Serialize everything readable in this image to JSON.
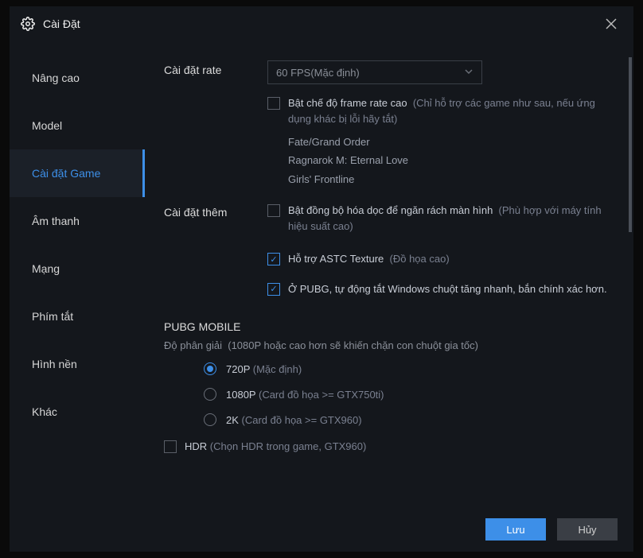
{
  "window": {
    "title": "Cài Đặt"
  },
  "sidebar": {
    "items": [
      {
        "label": "Nâng cao"
      },
      {
        "label": "Model"
      },
      {
        "label": "Cài đặt Game"
      },
      {
        "label": "Âm thanh"
      },
      {
        "label": "Mạng"
      },
      {
        "label": "Phím tắt"
      },
      {
        "label": "Hình nền"
      },
      {
        "label": "Khác"
      }
    ]
  },
  "rate": {
    "label": "Cài đặt rate",
    "selected": "60 FPS(Mặc định)",
    "highfps_label": "Bật chế độ frame rate cao",
    "highfps_hint": "(Chỉ hỗ trợ các game như sau, nếu ứng dụng khác bị lỗi hãy tắt)",
    "games": [
      "Fate/Grand Order",
      "Ragnarok M: Eternal Love",
      "Girls' Frontline"
    ]
  },
  "extra": {
    "label": "Cài đặt thêm",
    "vsync_label": "Bật đồng bộ hóa dọc để ngăn rách màn hình",
    "vsync_hint": "(Phù hợp với máy tính hiệu suất cao)",
    "astc_label": "Hỗ trợ ASTC Texture",
    "astc_hint": "(Đồ họa cao)",
    "pubg_mouse_label": "Ở PUBG, tự động tắt Windows chuột tăng nhanh, bắn chính xác hơn."
  },
  "pubg": {
    "heading": "PUBG MOBILE",
    "res_label": "Độ phân giải",
    "res_hint": "(1080P hoặc cao hơn sẽ khiến chặn con chuột gia tốc)",
    "options": [
      {
        "label": "720P",
        "hint": "(Mặc định)"
      },
      {
        "label": "1080P",
        "hint": "(Card đồ họa >= GTX750ti)"
      },
      {
        "label": "2K",
        "hint": "(Card đồ họa >= GTX960)"
      }
    ],
    "hdr_label": "HDR",
    "hdr_hint": "(Chọn HDR trong game, GTX960)"
  },
  "footer": {
    "save": "Lưu",
    "cancel": "Hủy"
  }
}
